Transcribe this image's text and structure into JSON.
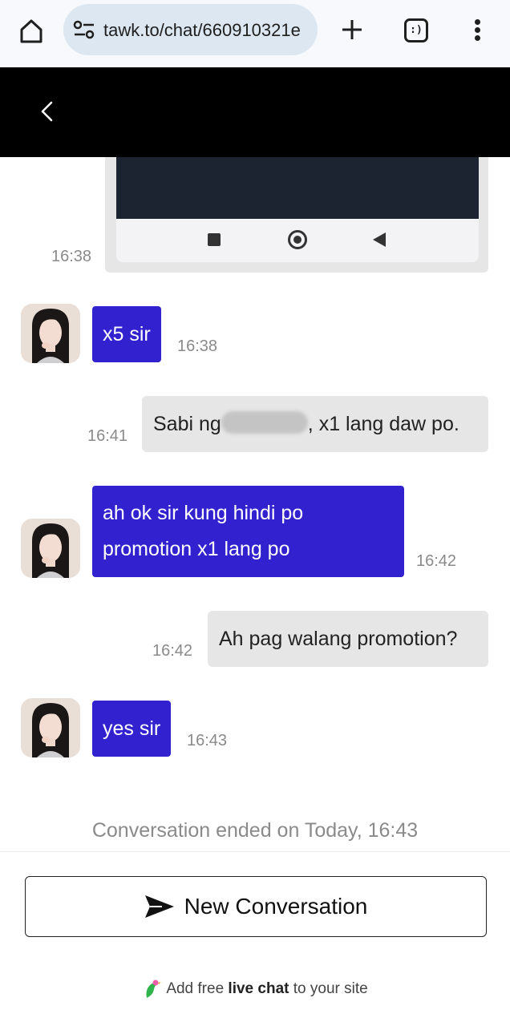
{
  "browser": {
    "url": "tawk.to/chat/660910321e",
    "tabs_icon_text": ":)"
  },
  "messages": [
    {
      "from": "user",
      "type": "image",
      "time": "16:38"
    },
    {
      "from": "agent",
      "text": "x5 sir",
      "time": "16:38"
    },
    {
      "from": "user",
      "text_before": "Sabi ng",
      "text_after": ", x1 lang daw po.",
      "time": "16:41"
    },
    {
      "from": "agent",
      "line1": "ah ok sir kung hindi po",
      "line2": "promotion x1 lang po",
      "time": "16:42"
    },
    {
      "from": "user",
      "text": "Ah pag walang promotion?",
      "time": "16:42"
    },
    {
      "from": "agent",
      "text": "yes sir",
      "time": "16:43"
    }
  ],
  "status": {
    "ended": "Conversation ended on Today, 16:43"
  },
  "footer": {
    "new_conversation": "New Conversation",
    "powered_prefix": "Add free",
    "powered_bold": "live chat",
    "powered_suffix": "to your site"
  },
  "colors": {
    "agent_bubble": "#3221cf",
    "user_bubble": "#e6e6e6",
    "header": "#000000"
  }
}
